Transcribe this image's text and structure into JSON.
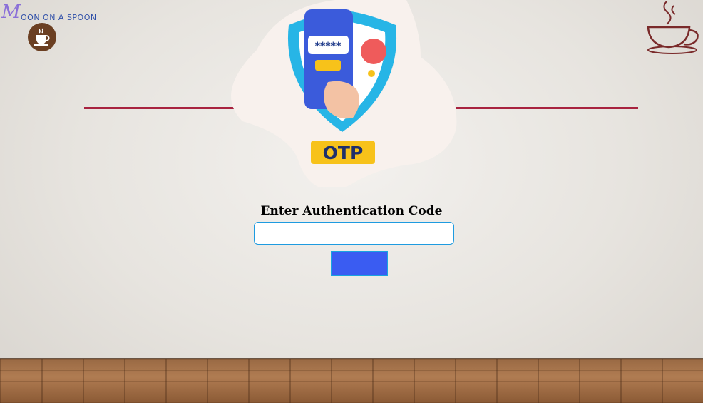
{
  "logo": {
    "mark": "M",
    "text": "OON ON A SPOON",
    "badge_icon": "coffee-cup-icon"
  },
  "decor": {
    "top_right_icon": "steaming-cup-icon",
    "divider_color": "#a8233f"
  },
  "illustration": {
    "icon": "otp-phone-shield-icon",
    "password_mask": "*****",
    "badge_text": "OTP"
  },
  "form": {
    "title": "Enter Authentication Code",
    "code_input": {
      "value": "",
      "placeholder": ""
    },
    "submit_label": "",
    "accent": "#3a5cf2",
    "border": "#1e9be0"
  }
}
